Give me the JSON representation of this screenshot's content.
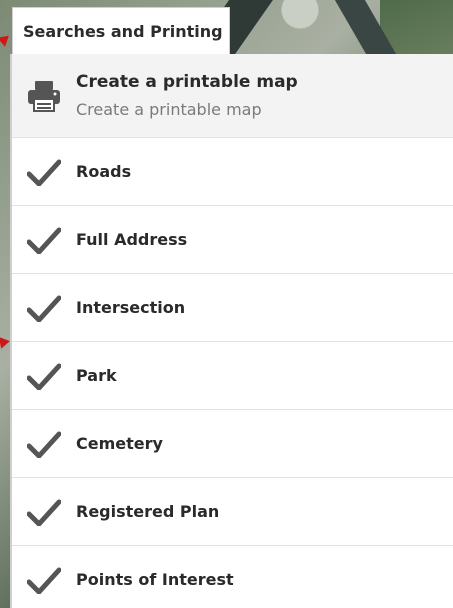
{
  "tab": {
    "label": "Searches and Printing"
  },
  "print_item": {
    "title": "Create a printable map",
    "subtitle": "Create a printable map",
    "icon": "printer-icon"
  },
  "search_items": [
    {
      "label": "Roads",
      "icon": "checkmark-icon"
    },
    {
      "label": "Full Address",
      "icon": "checkmark-icon"
    },
    {
      "label": "Intersection",
      "icon": "checkmark-icon"
    },
    {
      "label": "Park",
      "icon": "checkmark-icon"
    },
    {
      "label": "Cemetery",
      "icon": "checkmark-icon"
    },
    {
      "label": "Registered Plan",
      "icon": "checkmark-icon"
    },
    {
      "label": "Points of Interest",
      "icon": "checkmark-icon"
    }
  ],
  "colors": {
    "text": "#2a2a2a",
    "subtext": "#7a7a7a",
    "icon": "#555555",
    "callout": "#d11616"
  }
}
